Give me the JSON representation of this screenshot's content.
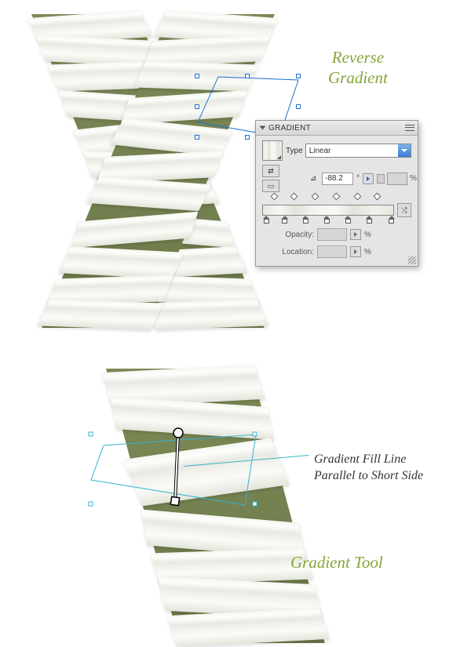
{
  "labels": {
    "reverse_gradient_l1": "Reverse",
    "reverse_gradient_l2": "Gradient",
    "gradient_tool": "Gradient Tool"
  },
  "callout": {
    "line1": "Gradient Fill Line",
    "line2": "Parallel to Short Side"
  },
  "panel": {
    "title": "GRADIENT",
    "type_label": "Type",
    "type_value": "Linear",
    "angle_value": "-88.2",
    "opacity_label": "Opacity:",
    "location_label": "Location:",
    "percent": "%",
    "degree": "°"
  },
  "gradient": {
    "stops_count": 7,
    "diamond_positions": [
      7,
      22,
      38,
      54,
      70,
      85
    ],
    "stop_positions": [
      0,
      14,
      30,
      46,
      62,
      78,
      95
    ]
  }
}
